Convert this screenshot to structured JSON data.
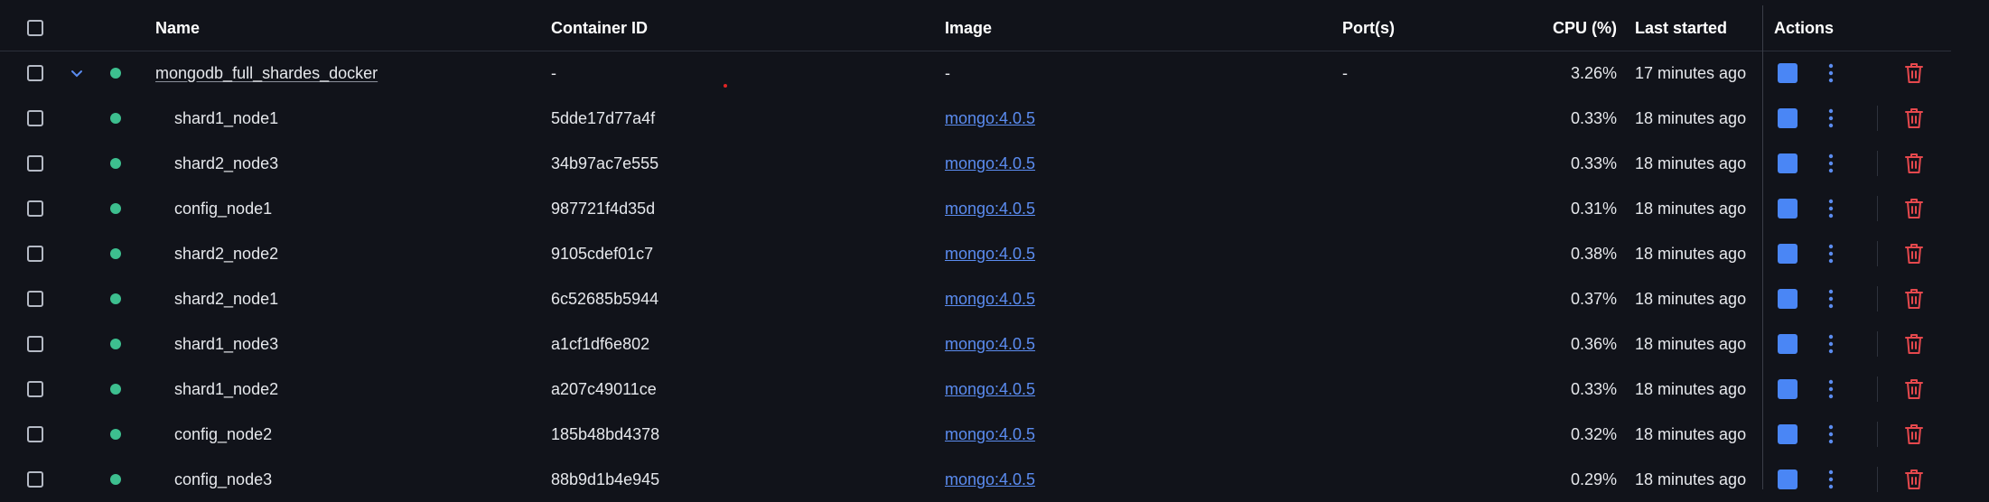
{
  "header": {
    "name": "Name",
    "container_id": "Container ID",
    "image": "Image",
    "ports": "Port(s)",
    "cpu": "CPU (%)",
    "last_started": "Last started",
    "actions": "Actions"
  },
  "group": {
    "name": "mongodb_full_shardes_docker",
    "container_id": "-",
    "image": "-",
    "ports": "-",
    "cpu": "3.26%",
    "last_started": "17 minutes ago"
  },
  "containers": [
    {
      "name": "shard1_node1",
      "container_id": "5dde17d77a4f",
      "image": "mongo:4.0.5",
      "cpu": "0.33%",
      "last_started": "18 minutes ago"
    },
    {
      "name": "shard2_node3",
      "container_id": "34b97ac7e555",
      "image": "mongo:4.0.5",
      "cpu": "0.33%",
      "last_started": "18 minutes ago"
    },
    {
      "name": "config_node1",
      "container_id": "987721f4d35d",
      "image": "mongo:4.0.5",
      "cpu": "0.31%",
      "last_started": "18 minutes ago"
    },
    {
      "name": "shard2_node2",
      "container_id": "9105cdef01c7",
      "image": "mongo:4.0.5",
      "cpu": "0.38%",
      "last_started": "18 minutes ago"
    },
    {
      "name": "shard2_node1",
      "container_id": "6c52685b5944",
      "image": "mongo:4.0.5",
      "cpu": "0.37%",
      "last_started": "18 minutes ago"
    },
    {
      "name": "shard1_node3",
      "container_id": "a1cf1df6e802",
      "image": "mongo:4.0.5",
      "cpu": "0.36%",
      "last_started": "18 minutes ago"
    },
    {
      "name": "shard1_node2",
      "container_id": "a207c49011ce",
      "image": "mongo:4.0.5",
      "cpu": "0.33%",
      "last_started": "18 minutes ago"
    },
    {
      "name": "config_node2",
      "container_id": "185b48bd4378",
      "image": "mongo:4.0.5",
      "cpu": "0.32%",
      "last_started": "18 minutes ago"
    },
    {
      "name": "config_node3",
      "container_id": "88b9d1b4e945",
      "image": "mongo:4.0.5",
      "cpu": "0.29%",
      "last_started": "18 minutes ago"
    }
  ],
  "icons": {
    "checkbox": "checkbox-icon",
    "chevron": "chevron-down-icon",
    "status": "running-status-dot",
    "stop": "stop-icon",
    "more": "more-vertical-icon",
    "delete": "trash-icon"
  },
  "colors": {
    "background": "#11131a",
    "running": "#3dbf8f",
    "link": "#5b8cf0",
    "stop": "#4a86f5",
    "delete": "#e5484d"
  }
}
